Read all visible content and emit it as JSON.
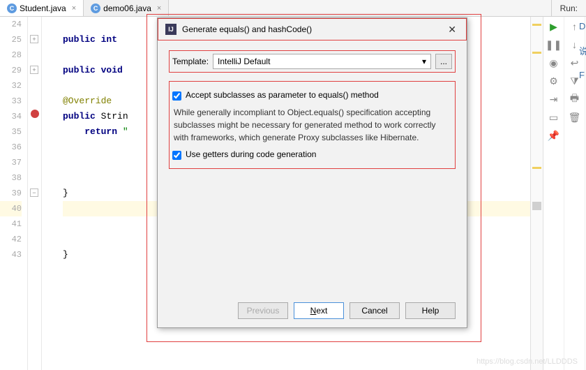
{
  "tabs": [
    {
      "icon": "C",
      "label": "Student.java"
    },
    {
      "icon": "C",
      "label": "demo06.java"
    }
  ],
  "run_label": "Run:",
  "line_numbers": [
    "24",
    "25",
    "28",
    "29",
    "32",
    "33",
    "34",
    "35",
    "36",
    "37",
    "38",
    "39",
    "40",
    "41",
    "42",
    "43"
  ],
  "code": {
    "l25": "public int ",
    "l29": "public void ",
    "l33": "@Override",
    "l34a": "public ",
    "l34b": "Strin",
    "l35a": "return ",
    "l35b": "\"",
    "l39": "}",
    "l43": "}"
  },
  "dialog": {
    "title": "Generate equals() and hashCode()",
    "template_label": "Template:",
    "template_value": "IntelliJ Default",
    "chk1": "Accept subclasses as parameter to equals() method",
    "desc": "While generally incompliant to Object.equals() specification accepting subclasses might be necessary for generated method to work correctly with frameworks, which generate Proxy subclasses like Hibernate.",
    "chk2": "Use getters during code generation",
    "buttons": {
      "prev": "Previous",
      "next": "Next",
      "cancel": "Cancel",
      "help": "Help"
    }
  },
  "far_right": [
    "D",
    "说",
    "F"
  ],
  "watermark": "https://blog.csdn.net/LLDDDS"
}
